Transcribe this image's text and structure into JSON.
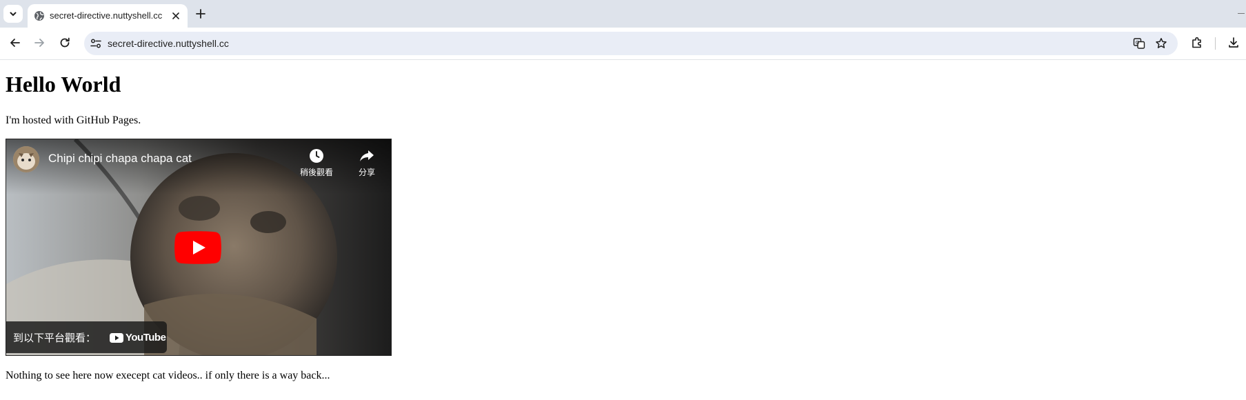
{
  "browser": {
    "tab": {
      "title": "secret-directive.nuttyshell.cc"
    },
    "address_bar": {
      "url": "secret-directive.nuttyshell.cc"
    }
  },
  "page": {
    "heading": "Hello World",
    "intro": "I'm hosted with GitHub Pages.",
    "video": {
      "title": "Chipi chipi chapa chapa cat",
      "watch_later_label": "稍後觀看",
      "share_label": "分享",
      "watch_on_label": "到以下平台觀看：",
      "youtube_logo_text": "YouTube"
    },
    "footer_text": "Nothing to see here now execept cat videos.. if only there is a way back..."
  }
}
